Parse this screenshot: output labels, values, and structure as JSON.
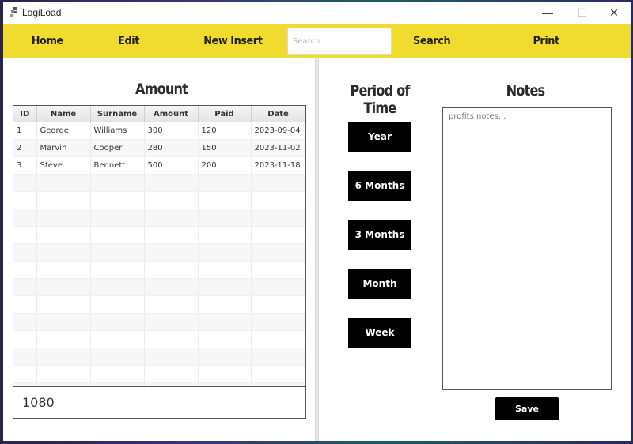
{
  "window": {
    "title": "LogiLoad",
    "controls": {
      "minimize": "—",
      "maximize": "☐",
      "close": "✕"
    }
  },
  "navbar": {
    "home": "Home",
    "edit": "Edit",
    "new_insert": "New Insert",
    "search_input": {
      "value": "",
      "placeholder": "Search"
    },
    "search": "Search",
    "print": "Print",
    "background_color": "#f0dc2e"
  },
  "amount_panel": {
    "heading": "Amount",
    "table": {
      "columns": [
        "ID",
        "Name",
        "Surname",
        "Amount",
        "Paid",
        "Date"
      ],
      "rows": [
        [
          "1",
          "George",
          "Williams",
          "300",
          "120",
          "2023-09-04"
        ],
        [
          "2",
          "Marvin",
          "Cooper",
          "280",
          "150",
          "2023-11-02"
        ],
        [
          "3",
          "Steve",
          "Bennett",
          "500",
          "200",
          "2023-11-18"
        ]
      ]
    },
    "total": "1080"
  },
  "period_panel": {
    "heading": "Period of Time",
    "buttons": [
      "Year",
      "6 Months",
      "3 Months",
      "Month",
      "Week"
    ]
  },
  "notes_panel": {
    "heading": "Notes",
    "textarea": {
      "value": "",
      "placeholder": "profits notes..."
    },
    "save": "Save"
  }
}
